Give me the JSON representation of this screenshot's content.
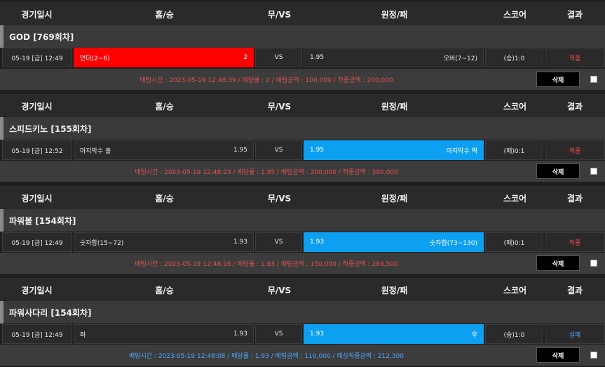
{
  "header": {
    "date": "경기일시",
    "home": "홈/승",
    "vs": "무/VS",
    "away": "원정/패",
    "score": "스코어",
    "result": "결과"
  },
  "bets": [
    {
      "game_title": "GOD [769회차]",
      "date": "05-19 [금] 12:49",
      "home_label": "언더(2~6)",
      "home_odds": "2",
      "vs": "VS",
      "away_odds": "1.95",
      "away_label": "오버(7~12)",
      "score": "(승)1:0",
      "result": "적중",
      "info": "배팅시간 : 2023-05-19 12:48:39 / 배당률 : 2 / 배팅금액 : 100,000 / 적중금액 : 200,000",
      "delete_label": "삭제"
    },
    {
      "game_title": "스피드키노 [155회차]",
      "date": "05-19 [금] 12:52",
      "home_label": "마지막수 홀",
      "home_odds": "1.95",
      "vs": "VS",
      "away_odds": "1.95",
      "away_label": "마지막수 짝",
      "score": "(패)0:1",
      "result": "적중",
      "info": "배팅시간 : 2023-05-19 12:48:23 / 배당률 : 1.95 / 배팅금액 : 200,000 / 적중금액 : 390,000",
      "delete_label": "삭제"
    },
    {
      "game_title": "파워볼 [154회차]",
      "date": "05-19 [금] 12:49",
      "home_label": "숫자합(15~72)",
      "home_odds": "1.93",
      "vs": "VS",
      "away_odds": "1.93",
      "away_label": "숫자합(73~130)",
      "score": "(패)0:1",
      "result": "적중",
      "info": "배팅시간 : 2023-05-19 12:48:16 / 배당률 : 1.93 / 배팅금액 : 150,000 / 적중금액 : 289,500",
      "delete_label": "삭제"
    },
    {
      "game_title": "파워사다리 [154회차]",
      "date": "05-19 [금] 12:49",
      "home_label": "좌",
      "home_odds": "1.93",
      "vs": "VS",
      "away_odds": "1.93",
      "away_label": "우",
      "score": "(승)1:0",
      "result": "실패",
      "info": "배팅시간 : 2023-05-19 12:48:08 / 배당률 : 1.93 / 배팅금액 : 110,000 / 예상적중금액 : 212,300",
      "delete_label": "삭제"
    }
  ],
  "colors": {
    "selected_home": "#ff0000",
    "selected_away": "#0ea0f0",
    "win": "#ff4d4d",
    "lose": "#4da6ff"
  }
}
